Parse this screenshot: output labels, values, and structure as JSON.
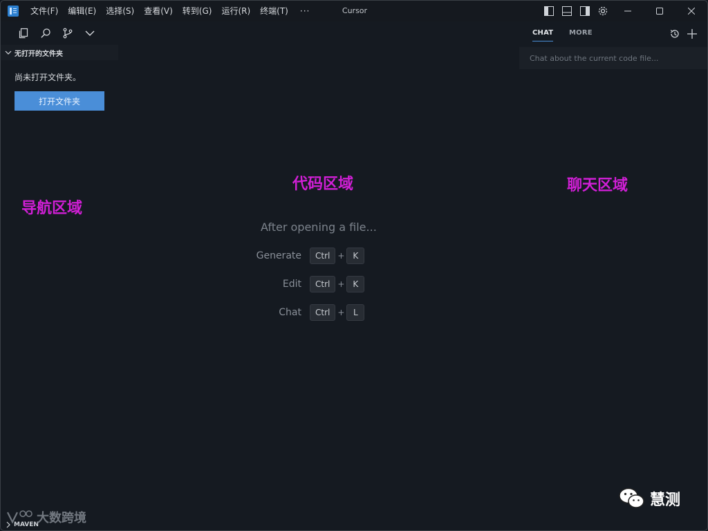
{
  "window": {
    "title": "Cursor",
    "menu": [
      "文件(F)",
      "编辑(E)",
      "选择(S)",
      "查看(V)",
      "转到(G)",
      "运行(R)",
      "终端(T)"
    ],
    "menu_more": "···"
  },
  "colors": {
    "background": "#151a21",
    "primary_button": "#4a8ed8",
    "annotation": "#d11fd6",
    "tab_underline": "#4a8ed8"
  },
  "activity_bar": {
    "icons": [
      "files-icon",
      "search-icon",
      "source-control-icon",
      "chevron-down-icon"
    ]
  },
  "sidebar": {
    "section_header": "无打开的文件夹",
    "empty_message": "尚未打开文件夹。",
    "open_folder_button": "打开文件夹",
    "bottom_section": "MAVEN"
  },
  "editor": {
    "hint_title": "After opening a file...",
    "shortcuts": [
      {
        "label": "Generate",
        "keys": [
          "Ctrl",
          "K"
        ]
      },
      {
        "label": "Edit",
        "keys": [
          "Ctrl",
          "K"
        ]
      },
      {
        "label": "Chat",
        "keys": [
          "Ctrl",
          "L"
        ]
      }
    ],
    "plus": "+"
  },
  "chat": {
    "tabs": [
      "CHAT",
      "MORE"
    ],
    "input_placeholder": "Chat about the current code file..."
  },
  "annotations": {
    "nav": "导航区域",
    "code": "代码区域",
    "chat": "聊天区域"
  },
  "watermarks": {
    "left": "大数跨境",
    "right": "慧测"
  }
}
